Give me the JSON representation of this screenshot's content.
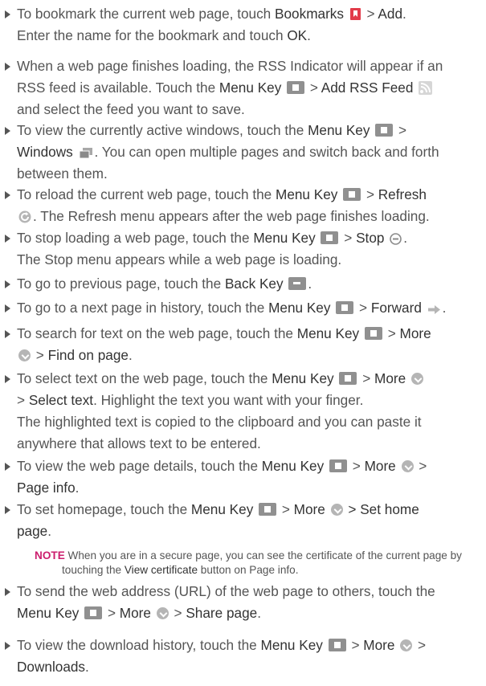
{
  "items": [
    {
      "p1": "To bookmark the current web page, touch ",
      "k1": "Bookmarks",
      "p2": " > ",
      "k2": "Add",
      "p3": ".",
      "l2a": "Enter the name for the bookmark and touch ",
      "l2k": "OK",
      "l2b": "."
    },
    {
      "l1": "When a web page finishes loading, the RSS Indicator will appear if an",
      "l2a": "RSS feed is available. Touch the ",
      "l2k1": "Menu Key",
      "l2b": " > ",
      "l2k2": "Add RSS Feed",
      "l3": "and select the feed you want to save."
    },
    {
      "p1": "To view the currently active windows, touch the ",
      "k1": "Menu Key",
      "p2": " >",
      "l2k": "Windows",
      "l2a": ". You can open multiple pages and switch back and forth",
      "l3": "between them."
    },
    {
      "p1": "To reload the current web page, touch the ",
      "k1": "Menu Key",
      "p2": " > ",
      "k2": "Refresh",
      "l2": ". The Refresh menu appears after the web page finishes loading."
    },
    {
      "p1": "To stop loading a web page, touch the ",
      "k1": "Menu Key",
      "p2": " > ",
      "k2": "Stop",
      "p3": ".",
      "l2": "The Stop menu appears while a web page is loading."
    },
    {
      "p1": "To go to previous page, touch the ",
      "k1": "Back Key",
      "p2": "."
    },
    {
      "p1": "To go to a next page in history, touch the ",
      "k1": "Menu Key",
      "p2": " > ",
      "k2": "Forward",
      "p3": "."
    },
    {
      "p1": "To search for text on the web page, touch the ",
      "k1": "Menu Key",
      "p2": " > ",
      "k2": "More",
      "l2a": " > ",
      "l2k": "Find on page",
      "l2b": "."
    },
    {
      "p1": "To select text on the web page, touch the ",
      "k1": "Menu Key",
      "p2": " > ",
      "k2": "More",
      "l2a": "> ",
      "l2k": "Select text",
      "l2b": ". Highlight the text you want with your finger.",
      "l3": "The highlighted text is copied to the clipboard and you can paste it",
      "l4": "anywhere that allows text to be entered."
    },
    {
      "p1": "To view the web page details, touch the ",
      "k1": "Menu Key",
      "p2": " > ",
      "k2": "More",
      "p3": " >",
      "l2k": "Page info",
      "l2a": "."
    },
    {
      "p1": "To set homepage, touch the ",
      "k1": "Menu Key",
      "p2": " > ",
      "k2": "More",
      "p3": " > ",
      "k3": "Set home",
      "l2k": "page",
      "l2a": "."
    },
    {
      "p1": "To send the web address (URL) of the web page to others, touch the",
      "l2k1": "Menu Key",
      "l2a": " > ",
      "l2k2": "More",
      "l2b": " > ",
      "l2k3": "Share page",
      "l2c": "."
    },
    {
      "p1": "To view the download history, touch the ",
      "k1": "Menu Key",
      "p2": " > ",
      "k2": "More",
      "p3": " >",
      "l2k": "Downloads",
      "l2a": "."
    }
  ],
  "note": {
    "label": "NOTE",
    "t1": " When you are in a secure page, you can see the certificate of the current page by",
    "t2a": "touching the ",
    "t2k": "View certificate",
    "t2b": " button on Page info."
  },
  "icons": {
    "bookmark_color": "#e23b4a",
    "key_color": "#909090",
    "more_color": "#b5b5b5",
    "note_color": "#cc1e6e"
  }
}
